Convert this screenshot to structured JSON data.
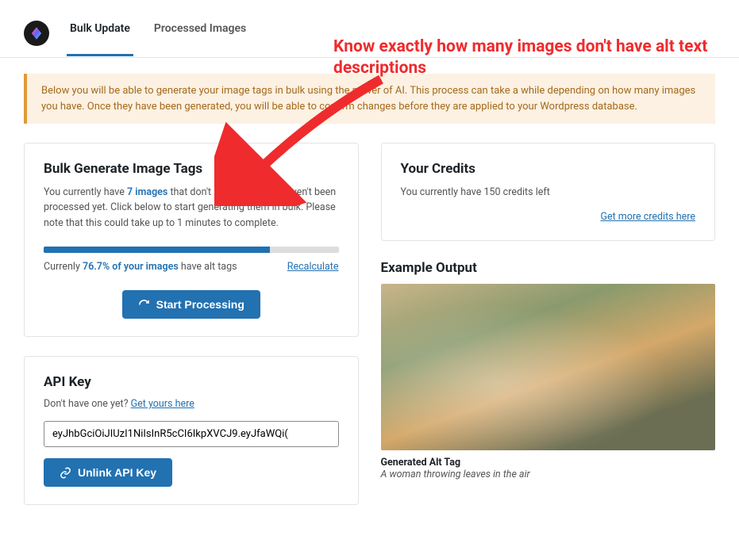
{
  "tabs": {
    "bulk_update": "Bulk Update",
    "processed_images": "Processed Images"
  },
  "annotation": "Know exactly how many images don't have alt text descriptions",
  "notice": "Below you will be able to generate your image tags in bulk using the power of AI. This process can take a while depending on how many images you have. Once they have been generated, you will be able to confirm changes before they are applied to your Wordpress database.",
  "bulk": {
    "title": "Bulk Generate Image Tags",
    "desc_pre": "You currently have ",
    "image_count": "7 images",
    "desc_post": " that don't have alt text or haven't been processed yet. Click below to start generating them in bulk. Please note that this could take up to 1 minutes to complete.",
    "progress_pre": "Currenly ",
    "progress_pct": "76.7% of your images",
    "progress_post": " have alt tags",
    "recalculate": "Recalculate",
    "start_button": "Start Processing"
  },
  "credits": {
    "title": "Your Credits",
    "desc": "You currently have 150 credits left",
    "link": "Get more credits here"
  },
  "apikey": {
    "title": "API Key",
    "sub_pre": "Don't have one yet? ",
    "sub_link": "Get yours here",
    "value": "eyJhbGciOiJIUzI1NiIsInR5cCI6IkpXVCJ9.eyJfaWQi(",
    "unlink_button": "Unlink API Key"
  },
  "example": {
    "title": "Example Output",
    "gen_label": "Generated Alt Tag",
    "gen_caption": "A woman throwing leaves in the air"
  }
}
